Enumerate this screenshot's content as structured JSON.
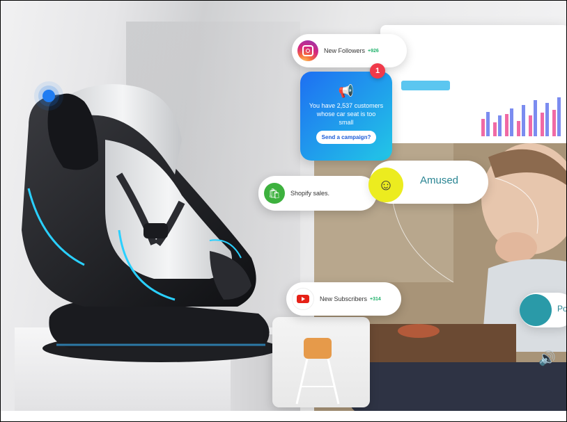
{
  "instagram_card": {
    "label": "New Followers",
    "delta": "+926",
    "icon": "instagram-icon"
  },
  "campaign_card": {
    "badge": "1",
    "message": "You have 2,537 customers whose car seat is too small",
    "button": "Send a campaign?",
    "icon": "megaphone-icon"
  },
  "shopify_card": {
    "label": "Shopify sales.",
    "icon": "shopify-bag-icon"
  },
  "emotion_card": {
    "label": "Amused",
    "icon": "smiley-icon"
  },
  "youtube_card": {
    "label": "New Subscribers",
    "delta": "+314",
    "icon": "youtube-icon"
  },
  "partial_card": {
    "label": "Po",
    "icon": "pomegranate-icon"
  },
  "colors": {
    "accent_blue": "#1e6ff2",
    "accent_teal": "#2a8593",
    "smiley_yellow": "#ecec1f",
    "badge_red": "#f03a4a",
    "growth_green": "#1fb16a"
  }
}
